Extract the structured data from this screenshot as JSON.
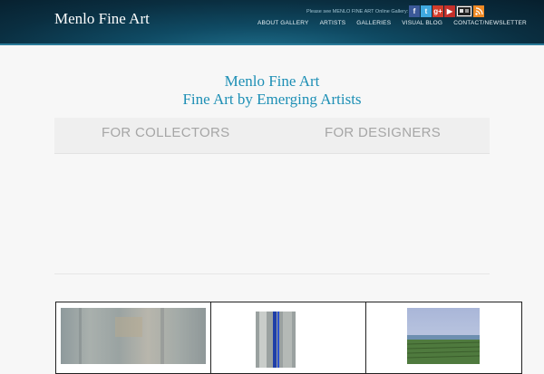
{
  "header": {
    "site_title": "Menlo Fine Art",
    "social_text": "Please see MENLO FINE ART Online Gallery:",
    "social_icons": [
      "facebook-icon",
      "twitter-icon",
      "google-plus-icon",
      "youtube-icon",
      "gallery-icon",
      "rss-icon"
    ],
    "nav": [
      "ABOUT GALLERY",
      "ARTISTS",
      "GALLERIES",
      "VISUAL BLOG",
      "CONTACT/NEWSLETTER"
    ]
  },
  "hero": {
    "line1": "Menlo Fine Art",
    "line2": "Fine Art by Emerging Artists"
  },
  "tabs": {
    "collectors": "FOR COLLECTORS",
    "designers": "FOR DESIGNERS"
  },
  "colors": {
    "accent": "#1d8fb5",
    "header_dark": "#0a2e40"
  }
}
